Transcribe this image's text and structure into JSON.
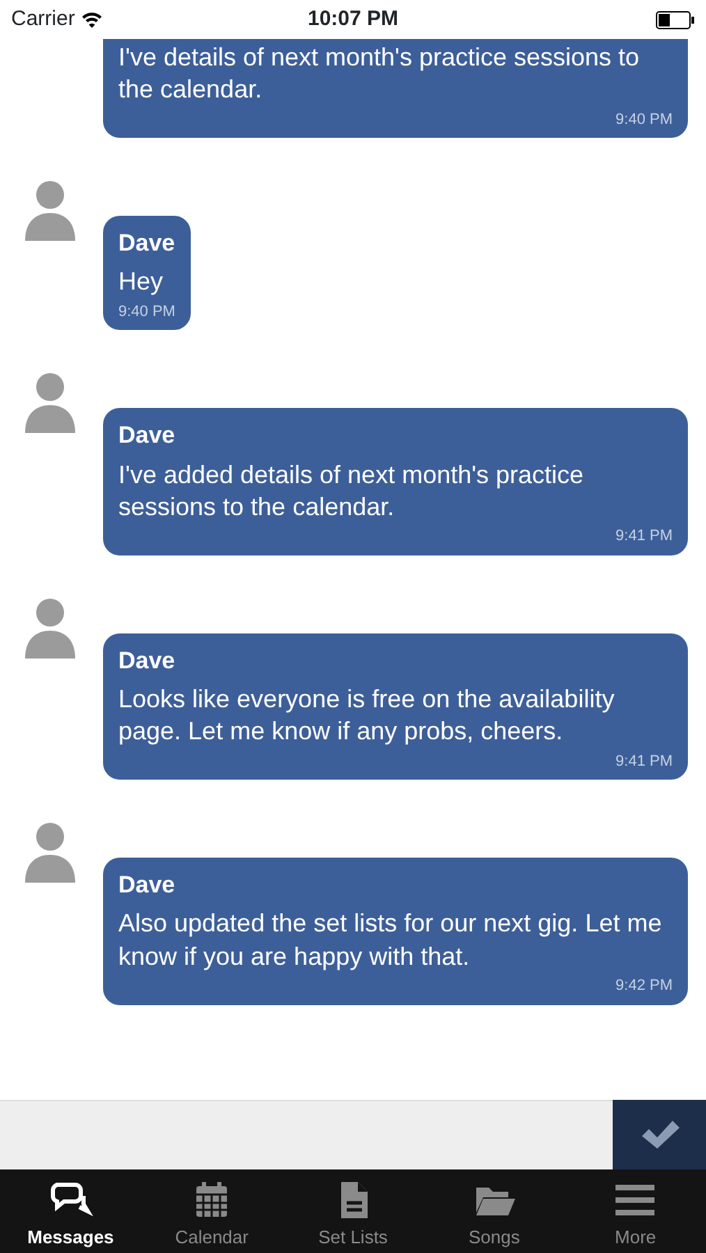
{
  "status_bar": {
    "carrier": "Carrier",
    "time": "10:07 PM"
  },
  "messages": [
    {
      "kind": "continued",
      "text": "I've details of next month's practice sessions to the calendar.",
      "time": "9:40 PM"
    },
    {
      "kind": "full",
      "sender": "Dave",
      "text": "Hey",
      "time": "9:40 PM"
    },
    {
      "kind": "full",
      "sender": "Dave",
      "text": "I've added details of next month's practice sessions to the calendar.",
      "time": "9:41 PM"
    },
    {
      "kind": "full",
      "sender": "Dave",
      "text": "Looks like everyone is free on the availability page. Let me know if any probs, cheers.",
      "time": "9:41 PM"
    },
    {
      "kind": "full",
      "sender": "Dave",
      "text": "Also updated the set lists for our next gig. Let me know if you are happy with that.",
      "time": "9:42 PM"
    }
  ],
  "tabs": [
    {
      "label": "Messages",
      "kind": "chat",
      "selected": true
    },
    {
      "label": "Calendar",
      "kind": "calendar",
      "selected": false
    },
    {
      "label": "Set Lists",
      "kind": "document",
      "selected": false
    },
    {
      "label": "Songs",
      "kind": "folder",
      "selected": false
    },
    {
      "label": "More",
      "kind": "menu",
      "selected": false
    }
  ]
}
